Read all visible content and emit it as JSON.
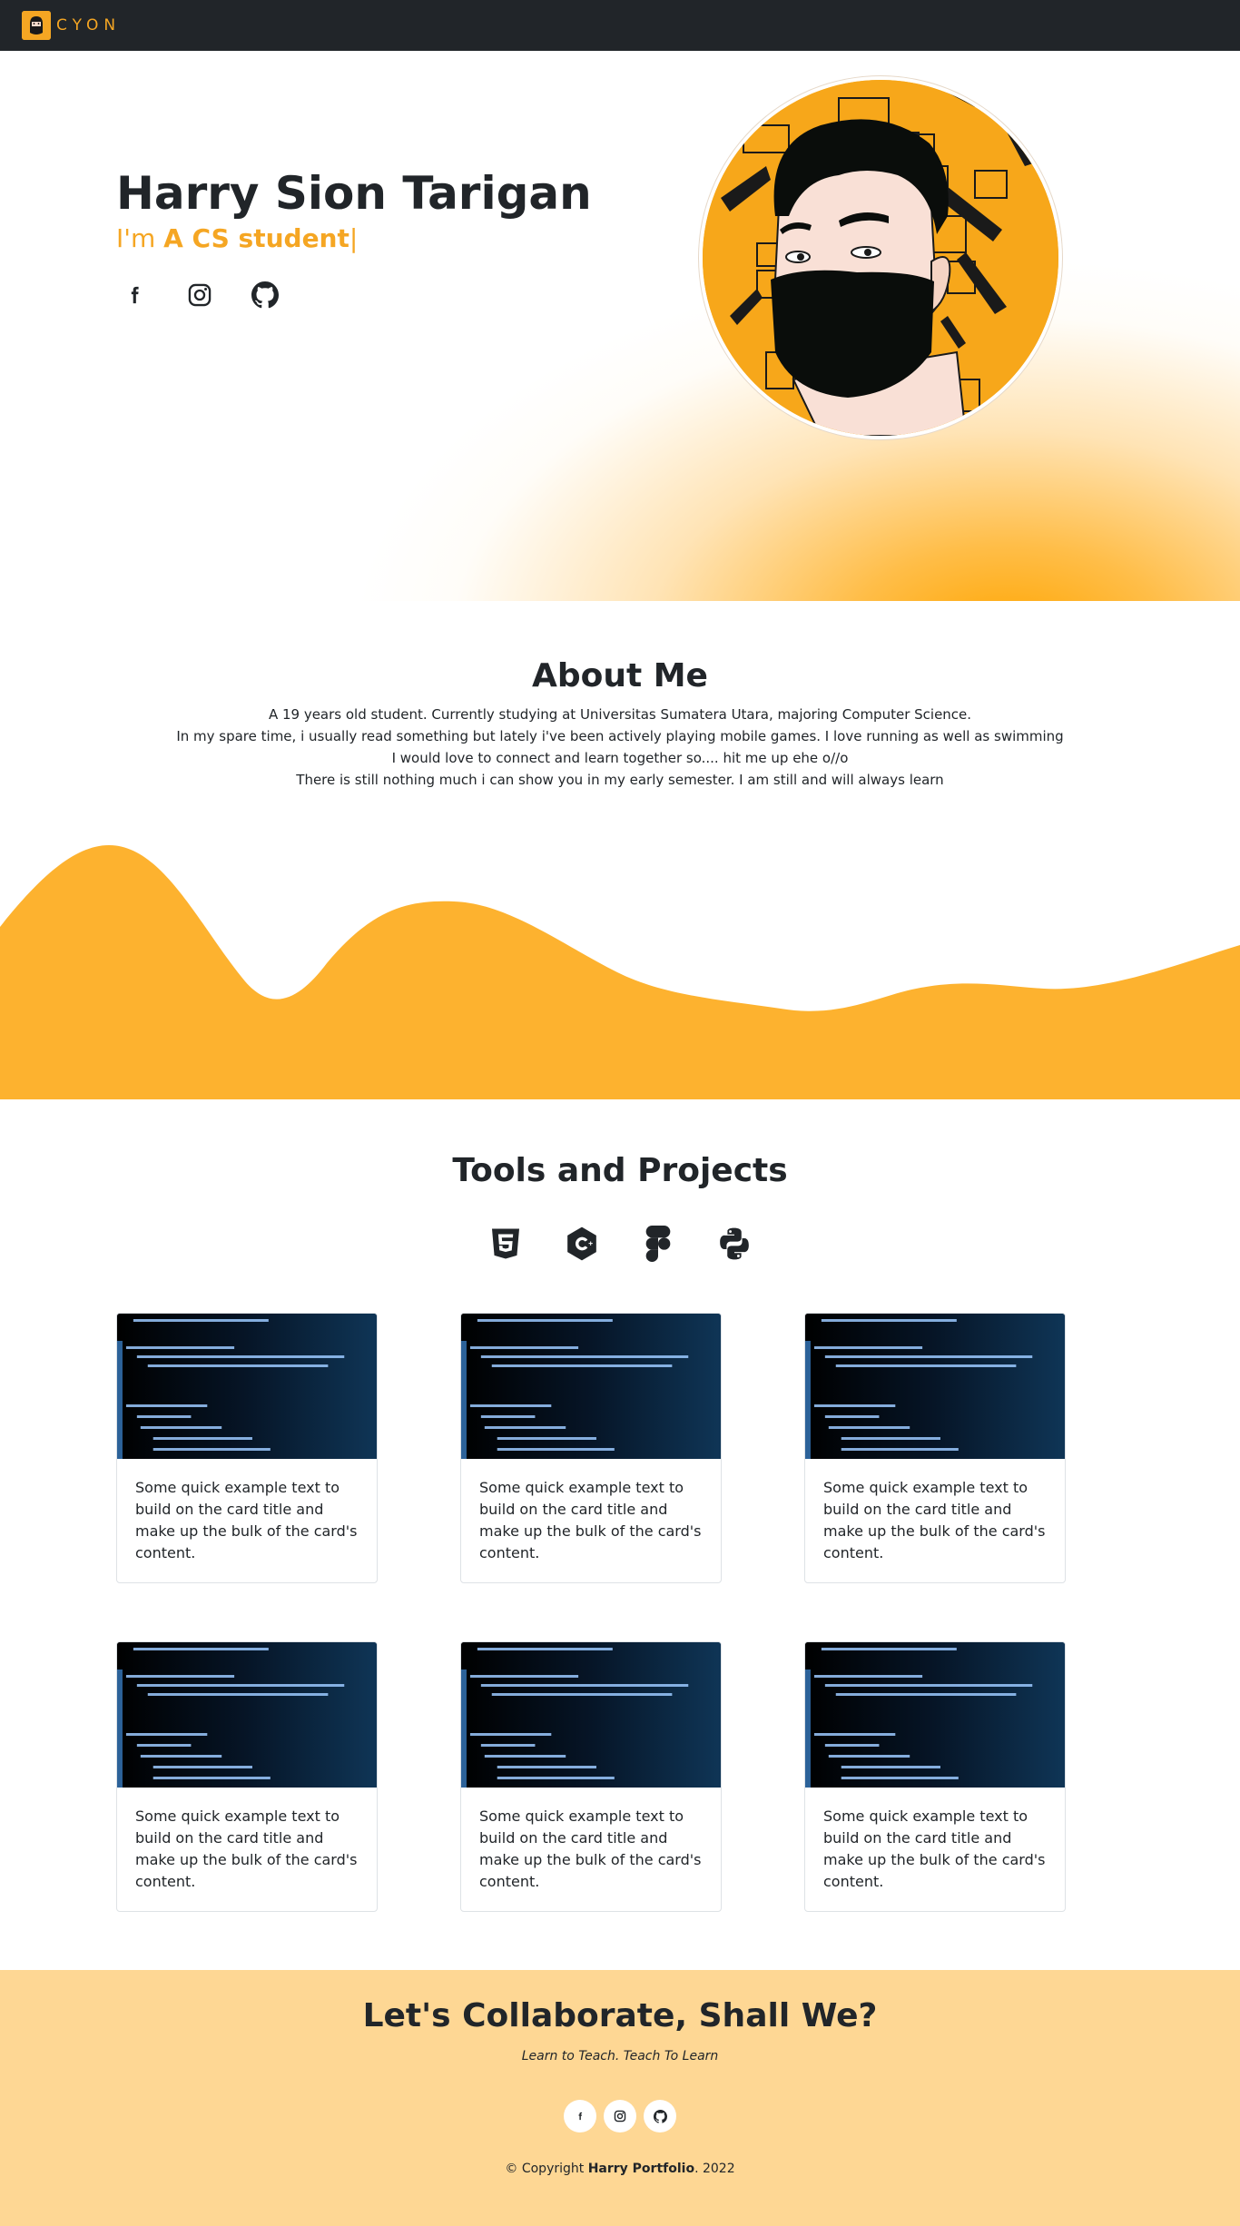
{
  "navbar": {
    "brand_text": "CYON"
  },
  "hero": {
    "name": "Harry Sion Tarigan",
    "typed_prefix": "I'm ",
    "typed_text": "A CS student",
    "caret": "|",
    "socials": [
      "facebook-icon",
      "instagram-icon",
      "github-icon"
    ]
  },
  "about": {
    "title": "About Me",
    "lines": [
      "A 19 years old student. Currently studying at Universitas Sumatera Utara, majoring Computer Science.",
      "In my spare time, i usually read something but lately i've been actively playing mobile games. I love running as well as swimming",
      "I would love to connect and learn together so.... hit me up ehe o//o",
      "There is still nothing much i can show you in my early semester. I am still and will always learn"
    ]
  },
  "tools": {
    "title": "Tools and Projects",
    "icons": [
      "html5-icon",
      "cplusplus-icon",
      "figma-icon",
      "python-icon"
    ],
    "cards": [
      {
        "text": "Some quick example text to build on the card title and make up the bulk of the card's content."
      },
      {
        "text": "Some quick example text to build on the card title and make up the bulk of the card's content."
      },
      {
        "text": "Some quick example text to build on the card title and make up the bulk of the card's content."
      },
      {
        "text": "Some quick example text to build on the card title and make up the bulk of the card's content."
      },
      {
        "text": "Some quick example text to build on the card title and make up the bulk of the card's content."
      },
      {
        "text": "Some quick example text to build on the card title and make up the bulk of the card's content."
      }
    ]
  },
  "footer": {
    "title": "Let's Collaborate, Shall We?",
    "tagline": "Learn to Teach. Teach To Learn",
    "socials": [
      "facebook-icon",
      "instagram-icon",
      "github-icon"
    ],
    "copyright_prefix": "© Copyright ",
    "copyright_brand": "Harry Portfolio",
    "copyright_suffix": ". 2022"
  },
  "colors": {
    "accent": "#f5a623",
    "navbar_bg": "#212529",
    "wave": "#fdb22f",
    "footer_bg": "#fed794"
  }
}
